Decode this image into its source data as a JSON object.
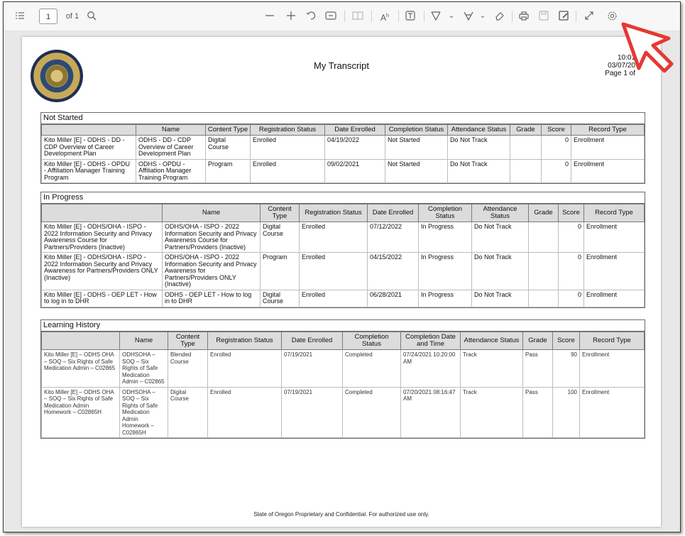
{
  "toolbar": {
    "page_current": "1",
    "page_of": "of 1",
    "icons": [
      "contents-icon",
      "search-icon",
      "zoom-out-icon",
      "zoom-in-icon",
      "rotate-icon",
      "fit-page-icon",
      "page-view-icon",
      "read-aloud-icon",
      "text-box-icon",
      "draw-icon",
      "highlight-icon",
      "eraser-icon",
      "print-icon",
      "save-icon",
      "save-as-icon",
      "fullscreen-icon",
      "settings-icon"
    ]
  },
  "document": {
    "title": "My Transcript",
    "time": "10:01",
    "date": "03/07/20",
    "page": "Page 1 of",
    "footer": "State of Oregon Proprietary and Confidential.  For authorized use only."
  },
  "not_started": {
    "title": "Not Started",
    "columns": [
      "",
      "Name",
      "Content Type",
      "Registration Status",
      "Date Enrolled",
      "Completion Status",
      "Attendance Status",
      "Grade",
      "Score",
      "Record Type"
    ],
    "rows": [
      [
        "Kito Miller [E] - ODHS - DD - CDP Overview of Career Development Plan",
        "ODHS - DD - CDP Overview of Career Development Plan",
        "Digital Course",
        "Enrolled",
        "04/19/2022",
        "Not Started",
        "Do Not Track",
        "",
        "0",
        "Enrollment"
      ],
      [
        "Kito Miller [E] - ODHS - OPDU - Affiliation Manager Training Program",
        "ODHS - OPDU - Affiliation Manager Training Program",
        "Program",
        "Enrolled",
        "09/02/2021",
        "Not Started",
        "Do Not Track",
        "",
        "0",
        "Enrollment"
      ]
    ]
  },
  "in_progress": {
    "title": "In Progress",
    "columns": [
      "",
      "Name",
      "Content Type",
      "Registration Status",
      "Date Enrolled",
      "Completion Status",
      "Attendance Status",
      "Grade",
      "Score",
      "Record Type"
    ],
    "rows": [
      [
        "Kito Miller [E] - ODHS/OHA - ISPO - 2022 Information Security and Privacy Awareness Course for Partners/Providers (Inactive)",
        "ODHS/OHA - ISPO - 2022 Information Security and Privacy Awareness Course for Partners/Providers (Inactive)",
        "Digital Course",
        "Enrolled",
        "07/12/2022",
        "In Progress",
        "Do Not Track",
        "",
        "0",
        "Enrollment"
      ],
      [
        "Kito Miller [E] - ODHS/OHA - ISPO - 2022 Information Security and Privacy Awareness for Partners/Providers ONLY (Inactive)",
        "ODHS/OHA - ISPO - 2022 Information Security and Privacy Awareness for Partners/Providers ONLY (Inactive)",
        "Program",
        "Enrolled",
        "04/15/2022",
        "In Progress",
        "Do Not Track",
        "",
        "0",
        "Enrollment"
      ],
      [
        "Kito Miller [E] - ODHS - OEP LET - How to log in to DHR",
        "ODHS - OEP LET - How to log in to DHR",
        "Digital Course",
        "Enrolled",
        "06/28/2021",
        "In Progress",
        "Do Not Track",
        "",
        "0",
        "Enrollment"
      ]
    ]
  },
  "learning_history": {
    "title": "Learning History",
    "columns": [
      "",
      "Name",
      "Content Type",
      "Registration Status",
      "Date Enrolled",
      "Completion Status",
      "Completion Date and Time",
      "Attendance Status",
      "Grade",
      "Score",
      "Record Type"
    ],
    "rows": [
      [
        "Kito Miller [E] – ODHS OHA – SOQ – Six Rights of Safe Medication Admin – C02865",
        "ODHSOHA – SOQ – Six Rights of Safe Medication Admin – C02865",
        "Blended Course",
        "Enrolled",
        "07/19/2021",
        "Completed",
        "07/24/2021 10:20:00 AM",
        "Track",
        "Pass",
        "90",
        "Enrollment"
      ],
      [
        "Kito Miller [E] – ODHS OHA – SOQ – Six Rights of Safe Medication Admin Homework – C02865H",
        "ODHSOHA – SOQ – Six Rights of Safe Medication Admin Homework – C02865H",
        "Digital Course",
        "Enrolled",
        "07/19/2021",
        "Completed",
        "07/20/2021 08:16:47 AM",
        "Track",
        "Pass",
        "100",
        "Enrollment"
      ]
    ]
  },
  "colors": {
    "cursor_outline": "#e53935",
    "header_bg": "#dcdcdc",
    "toolbar_bg": "#f7f7f7"
  }
}
